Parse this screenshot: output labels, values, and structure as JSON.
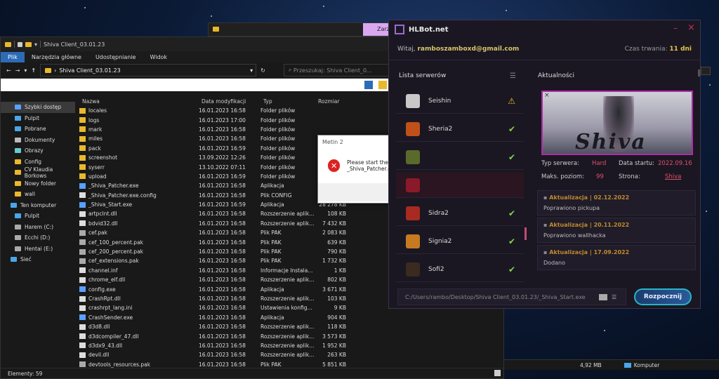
{
  "explorer": {
    "title": "Shiva Client_03.01.23",
    "ribbon": [
      "Plik",
      "Narzędzia główne",
      "Udostępnianie",
      "Widok"
    ],
    "path": "Shiva Client_03.01.23",
    "search_placeholder": "Przeszukaj: Shiva Client_0...",
    "columns": [
      "Nazwa",
      "Data modyfikacji",
      "Typ",
      "Rozmiar"
    ],
    "nav": [
      "Szybki dostęp",
      "Pulpit",
      "Pobrane",
      "Dokumenty",
      "Obrazy",
      "Config",
      "CV Klaudia Borkows",
      "Nowy folder",
      "wall",
      "Ten komputer",
      "Pulpit",
      "Harem (C:)",
      "Ecchi (D:)",
      "Hentai (E:)",
      "Sieć"
    ],
    "files": [
      [
        "locales",
        "16.01.2023 16:58",
        "Folder plików",
        ""
      ],
      [
        "logs",
        "16.01.2023 17:00",
        "Folder plików",
        ""
      ],
      [
        "mark",
        "16.01.2023 16:58",
        "Folder plików",
        ""
      ],
      [
        "miles",
        "16.01.2023 16:58",
        "Folder plików",
        ""
      ],
      [
        "pack",
        "16.01.2023 16:59",
        "Folder plików",
        ""
      ],
      [
        "screenshot",
        "13.09.2022 12:26",
        "Folder plików",
        ""
      ],
      [
        "syserr",
        "13.10.2022 07:11",
        "Folder plików",
        ""
      ],
      [
        "upload",
        "16.01.2023 16:59",
        "Folder plików",
        ""
      ],
      [
        "_Shiva_Patcher.exe",
        "16.01.2023 16:58",
        "Aplikacja",
        ""
      ],
      [
        "_Shiva_Patcher.exe.config",
        "16.01.2023 16:58",
        "Plik CONFIG",
        ""
      ],
      [
        "_Shiva_Start.exe",
        "16.01.2023 16:59",
        "Aplikacja",
        "28 278 KB"
      ],
      [
        "artpclnt.dll",
        "16.01.2023 16:58",
        "Rozszerzenie aplik...",
        "108 KB"
      ],
      [
        "bdvid32.dll",
        "16.01.2023 16:58",
        "Rozszerzenie aplik...",
        "7 432 KB"
      ],
      [
        "cef.pak",
        "16.01.2023 16:58",
        "Plik PAK",
        "2 083 KB"
      ],
      [
        "cef_100_percent.pak",
        "16.01.2023 16:58",
        "Plik PAK",
        "639 KB"
      ],
      [
        "cef_200_percent.pak",
        "16.01.2023 16:58",
        "Plik PAK",
        "790 KB"
      ],
      [
        "cef_extensions.pak",
        "16.01.2023 16:58",
        "Plik PAK",
        "1 732 KB"
      ],
      [
        "channel.inf",
        "16.01.2023 16:58",
        "Informacje Instala...",
        "1 KB"
      ],
      [
        "chrome_elf.dll",
        "16.01.2023 16:58",
        "Rozszerzenie aplik...",
        "802 KB"
      ],
      [
        "config.exe",
        "16.01.2023 16:58",
        "Aplikacja",
        "3 671 KB"
      ],
      [
        "CrashRpt.dll",
        "16.01.2023 16:58",
        "Rozszerzenie aplik...",
        "103 KB"
      ],
      [
        "crashrpt_lang.ini",
        "16.01.2023 16:58",
        "Ustawienia konfig...",
        "9 KB"
      ],
      [
        "CrashSender.exe",
        "16.01.2023 16:58",
        "Aplikacja",
        "904 KB"
      ],
      [
        "d3d8.dll",
        "16.01.2023 16:58",
        "Rozszerzenie aplik...",
        "118 KB"
      ],
      [
        "d3dcompiler_47.dll",
        "16.01.2023 16:58",
        "Rozszerzenie aplik...",
        "3 573 KB"
      ],
      [
        "d3dx9_43.dll",
        "16.01.2023 16:58",
        "Rozszerzenie aplik...",
        "1 952 KB"
      ],
      [
        "devil.dll",
        "16.01.2023 16:58",
        "Rozszerzenie aplik...",
        "263 KB"
      ],
      [
        "devtools_resources.pak",
        "16.01.2023 16:58",
        "Plik PAK",
        "5 851 KB"
      ]
    ],
    "status": "Elementy: 59"
  },
  "bg_window": {
    "tab": "Zarz"
  },
  "dialog": {
    "title": "Metin 2",
    "message": "Please start the Client with _Shiva_Patcher.exe",
    "ok": "OK"
  },
  "hlbot": {
    "title": "HLBot.net",
    "welcome": "Witaj,",
    "email": "ramboszamboxd@gmail.com",
    "duration_label": "Czas trwania:",
    "duration": "11 dni",
    "servers_title": "Lista serwerów",
    "news_title": "Aktualności",
    "servers": [
      {
        "name": "Seishin",
        "status": "warning"
      },
      {
        "name": "Sheria2",
        "status": "ok"
      },
      {
        "name": "",
        "status": "ok"
      },
      {
        "name": "",
        "status": ""
      },
      {
        "name": "Sidra2",
        "status": "ok"
      },
      {
        "name": "Signia2",
        "status": "ok"
      },
      {
        "name": "Sofi2",
        "status": "ok"
      }
    ],
    "banner_text": "Shiva",
    "server_type_label": "Typ serwera:",
    "server_type": "Hard",
    "start_label": "Data startu:",
    "start": "2022.09.16",
    "max_level_label": "Maks. poziom:",
    "max_level": "99",
    "site_label": "Strona:",
    "site": "Shiva",
    "updates": [
      {
        "title": "Aktualizacja | 02.12.2022",
        "desc": "Poprawiono pickupa"
      },
      {
        "title": "Aktualizacja | 20.11.2022",
        "desc": "Poprawiono wallhacka"
      },
      {
        "title": "Aktualizacja | 17.09.2022",
        "desc": "Dodano"
      }
    ],
    "path": "C:/Users/rambo/Desktop/Shiva Client_03.01.23/_Shiva_Start.exe",
    "start_button": "Rozpocznij"
  },
  "taskbar_right": {
    "size": "4,92 MB",
    "computer": "Komputer"
  }
}
